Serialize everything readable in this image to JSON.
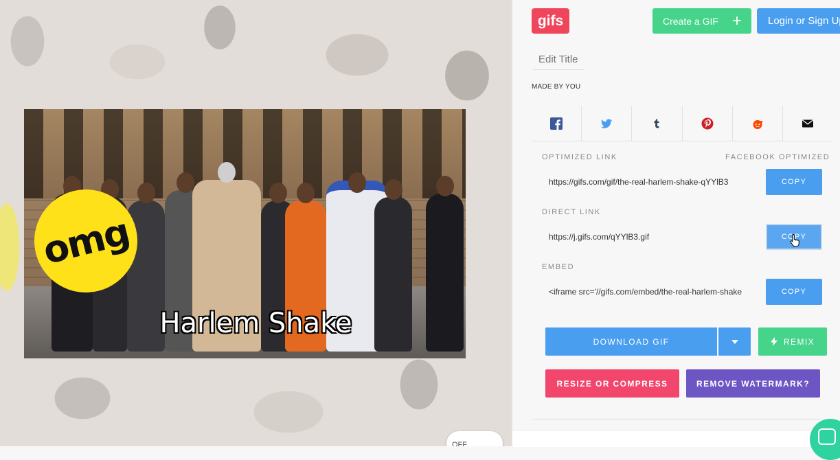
{
  "gif": {
    "sticker_text": "omg",
    "caption": "Harlem Shake",
    "toggle_label": "OFF"
  },
  "header": {
    "logo": "gifs",
    "create_label": "Create a GIF",
    "create_icon": "plus-icon",
    "login_label": "Login or Sign Up"
  },
  "title_input": {
    "placeholder": "Edit Title"
  },
  "made_by": "MADE BY YOU",
  "share": [
    {
      "name": "facebook",
      "icon": "facebook-icon",
      "color": "#3b5998"
    },
    {
      "name": "twitter",
      "icon": "twitter-icon",
      "color": "#4a9ef0"
    },
    {
      "name": "tumblr",
      "icon": "tumblr-icon",
      "color": "#35465c"
    },
    {
      "name": "pinterest",
      "icon": "pinterest-icon",
      "color": "#cb2027"
    },
    {
      "name": "reddit",
      "icon": "reddit-icon",
      "color": "#ff4500"
    },
    {
      "name": "email",
      "icon": "mail-icon",
      "color": "#111111"
    }
  ],
  "links": {
    "optimized_label": "OPTIMIZED LINK",
    "facebook_optimized_label": "FACEBOOK OPTIMIZED",
    "optimized_url": "https://gifs.com/gif/the-real-harlem-shake-qYYlB3",
    "direct_label": "DIRECT LINK",
    "direct_url": "https://j.gifs.com/qYYlB3.gif",
    "embed_label": "EMBED",
    "embed_code": "<iframe src='//gifs.com/embed/the-real-harlem-shake",
    "copy_label": "COPY"
  },
  "actions": {
    "download_label": "DOWNLOAD GIF",
    "remix_label": "REMIX",
    "resize_label": "RESIZE OR COMPRESS",
    "watermark_label": "REMOVE WATERMARK?"
  },
  "colors": {
    "brand": "#f0465b",
    "primary": "#4a9ef0",
    "green": "#45d48a",
    "pink": "#f2466c",
    "purple": "#6d55c4"
  }
}
